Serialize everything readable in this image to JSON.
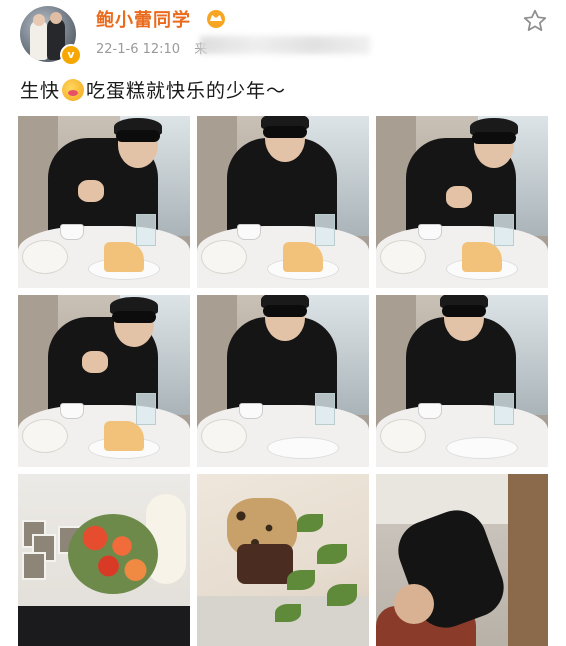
{
  "post": {
    "username": "鲍小蕾同学",
    "timestamp": "22-1-6 12:10",
    "source_prefix": "来",
    "text_before_emoji": "生快",
    "text_after_emoji": "吃蛋糕就快乐的少年～"
  },
  "icons": {
    "avatar": "avatar",
    "verified": "verified-badge-icon",
    "crown": "crown-icon",
    "star": "star-icon",
    "emoji": "drooling-emoji-icon"
  },
  "colors": {
    "username": "#ea6b1d",
    "verified_badge": "#f7a700",
    "timestamp": "#9a9a9a",
    "text": "#1a1a1a"
  },
  "photos": [
    {
      "id": "photo-1",
      "kind": "cafe"
    },
    {
      "id": "photo-2",
      "kind": "cafe"
    },
    {
      "id": "photo-3",
      "kind": "cafe"
    },
    {
      "id": "photo-4",
      "kind": "cafe"
    },
    {
      "id": "photo-5",
      "kind": "cafe"
    },
    {
      "id": "photo-6",
      "kind": "cafe"
    },
    {
      "id": "photo-7",
      "kind": "flowers"
    },
    {
      "id": "photo-8",
      "kind": "plant-cake"
    },
    {
      "id": "photo-9",
      "kind": "lying"
    }
  ]
}
